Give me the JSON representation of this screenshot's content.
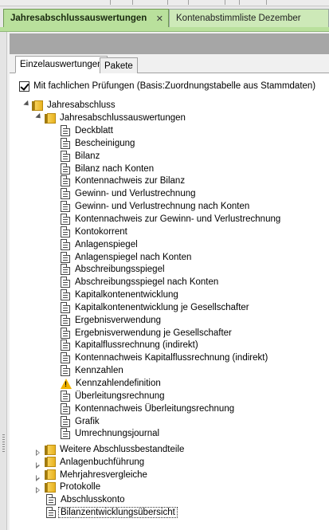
{
  "doc_tabs": [
    {
      "label": "Jahresabschlussauswertungen",
      "active": true
    },
    {
      "label": "Kontenabstimmliste Dezember",
      "active": false
    }
  ],
  "close_glyph": "✕",
  "sub_tabs": [
    {
      "label": "Einzelauswertungen",
      "active": true
    },
    {
      "label": "Pakete",
      "active": false
    }
  ],
  "checkbox": {
    "label": "Mit fachlichen Prüfungen (Basis:Zuordnungstabelle aus Stammdaten)",
    "checked": true
  },
  "tree": {
    "root": "Jahresabschluss",
    "group": "Jahresabschlussauswertungen",
    "items": [
      {
        "label": "Deckblatt",
        "icon": "document-icon"
      },
      {
        "label": "Bescheinigung",
        "icon": "document-icon"
      },
      {
        "label": "Bilanz",
        "icon": "document-icon"
      },
      {
        "label": "Bilanz nach Konten",
        "icon": "document-icon"
      },
      {
        "label": "Kontennachweis zur Bilanz",
        "icon": "document-icon"
      },
      {
        "label": "Gewinn- und Verlustrechnung",
        "icon": "document-icon"
      },
      {
        "label": "Gewinn- und Verlustrechnung nach Konten",
        "icon": "document-icon"
      },
      {
        "label": "Kontennachweis zur Gewinn- und Verlustrechnung",
        "icon": "document-icon"
      },
      {
        "label": "Kontokorrent",
        "icon": "document-icon"
      },
      {
        "label": "Anlagenspiegel",
        "icon": "document-icon"
      },
      {
        "label": "Anlagenspiegel nach Konten",
        "icon": "document-icon"
      },
      {
        "label": "Abschreibungsspiegel",
        "icon": "document-icon"
      },
      {
        "label": "Abschreibungsspiegel nach Konten",
        "icon": "document-icon"
      },
      {
        "label": "Kapitalkontenentwicklung",
        "icon": "document-icon"
      },
      {
        "label": "Kapitalkontenentwicklung je Gesellschafter",
        "icon": "document-icon"
      },
      {
        "label": "Ergebnisverwendung",
        "icon": "document-icon"
      },
      {
        "label": "Ergebnisverwendung je Gesellschafter",
        "icon": "document-icon"
      },
      {
        "label": "Kapitalflussrechnung (indirekt)",
        "icon": "document-icon"
      },
      {
        "label": "Kontennachweis Kapitalflussrechnung (indirekt)",
        "icon": "document-icon"
      },
      {
        "label": "Kennzahlen",
        "icon": "document-icon"
      },
      {
        "label": "Kennzahlendefinition",
        "icon": "warning-icon"
      },
      {
        "label": "Überleitungsrechnung",
        "icon": "document-icon"
      },
      {
        "label": "Kontennachweis Überleitungsrechnung",
        "icon": "document-icon"
      },
      {
        "label": "Grafik",
        "icon": "document-icon"
      },
      {
        "label": "Umrechnungsjournal",
        "icon": "document-icon"
      }
    ],
    "collapsed_folders": [
      "Weitere Abschlussbestandteile",
      "Anlagenbuchführung",
      "Mehrjahresvergleiche",
      "Protokolle"
    ],
    "bottom_docs": [
      {
        "label": "Abschlusskonto",
        "selected": false
      },
      {
        "label": "Bilanzentwicklungsübersicht",
        "selected": true
      }
    ]
  }
}
